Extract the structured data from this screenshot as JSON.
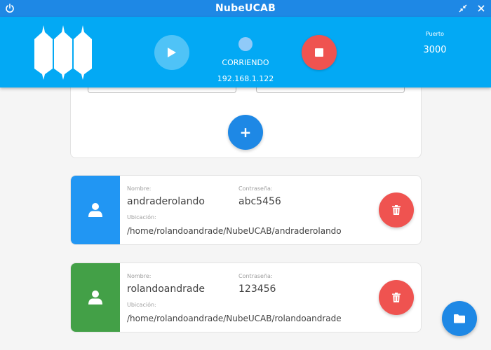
{
  "window": {
    "title": "NubeUCAB"
  },
  "header": {
    "status": "CORRIENDO",
    "ip": "192.168.1.122",
    "port_label": "Puerto",
    "port_value": "3000"
  },
  "users": [
    {
      "name_label": "Nombre:",
      "name": "andraderolando",
      "password_label": "Contraseña:",
      "password": "abc5456",
      "location_label": "Ubicación:",
      "location": "/home/rolandoandrade/NubeUCAB/andraderolando",
      "color": "#2196f3"
    },
    {
      "name_label": "Nombre:",
      "name": "rolandoandrade",
      "password_label": "Contraseña:",
      "password": "123456",
      "location_label": "Ubicación:",
      "location": "/home/rolandoandrade/NubeUCAB/rolandoandrade",
      "color": "#43a047"
    }
  ],
  "colors": {
    "titlebar": "#1e88e5",
    "header": "#03a9f4",
    "stop": "#ef5350",
    "primary": "#1e88e5"
  },
  "icons": {
    "add": "+"
  }
}
